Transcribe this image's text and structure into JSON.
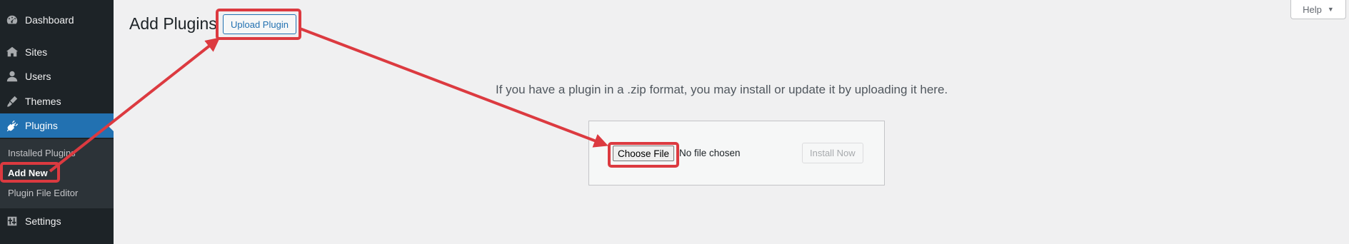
{
  "sidebar": {
    "items": [
      {
        "label": "Dashboard",
        "icon": "dashboard-icon"
      },
      {
        "label": "Sites",
        "icon": "sites-icon"
      },
      {
        "label": "Users",
        "icon": "users-icon"
      },
      {
        "label": "Themes",
        "icon": "themes-icon"
      },
      {
        "label": "Plugins",
        "icon": "plugins-icon",
        "active": true
      },
      {
        "label": "Settings",
        "icon": "settings-icon"
      }
    ],
    "submenu": [
      {
        "label": "Installed Plugins"
      },
      {
        "label": "Add New",
        "current": true
      },
      {
        "label": "Plugin File Editor"
      }
    ]
  },
  "header": {
    "title": "Add Plugins",
    "upload_button": "Upload Plugin",
    "help": "Help"
  },
  "upload": {
    "description": "If you have a plugin in a .zip format, you may install or update it by uploading it here.",
    "choose_file": "Choose File",
    "no_file": "No file chosen",
    "install_now": "Install Now"
  },
  "colors": {
    "sidebar_bg": "#1d2327",
    "accent": "#2271b1",
    "annotation": "#dc3a40"
  }
}
